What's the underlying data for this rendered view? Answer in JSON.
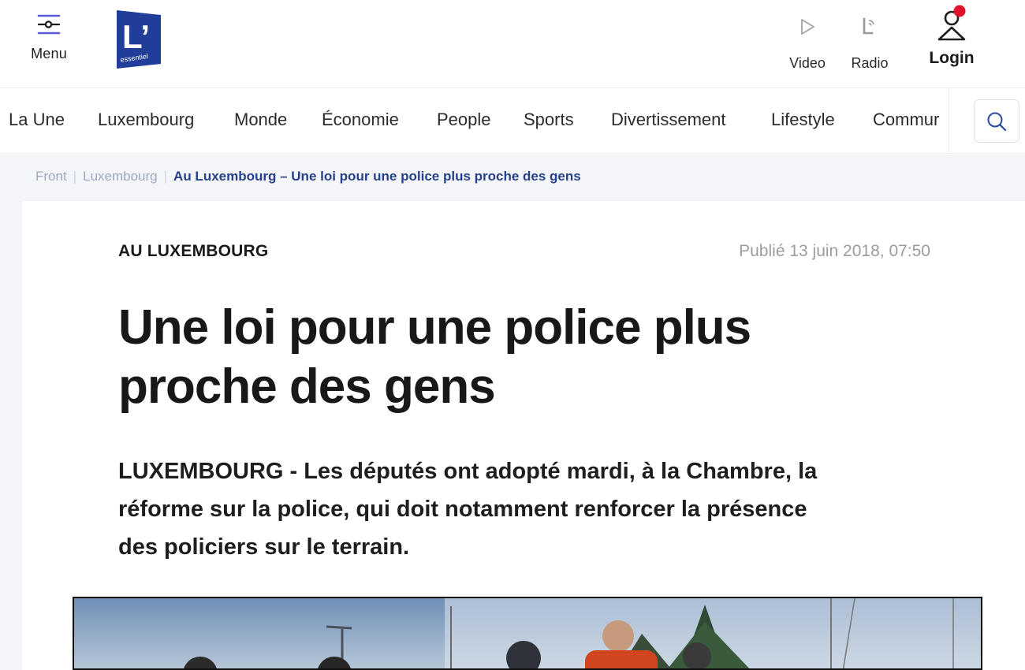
{
  "header": {
    "menu_label": "Menu",
    "logo_text": "L’",
    "logo_subtext": "essentiel",
    "video_label": "Video",
    "radio_label": "Radio",
    "login_label": "Login"
  },
  "nav": {
    "categories": [
      "La Une",
      "Luxembourg",
      "Monde",
      "Économie",
      "People",
      "Sports",
      "Divertissement",
      "Lifestyle",
      "Commur"
    ]
  },
  "breadcrumb": {
    "items": [
      "Front",
      "Luxembourg"
    ],
    "current": "Au Luxembourg – Une loi pour une police plus proche des gens"
  },
  "article": {
    "kicker": "AU LUXEMBOURG",
    "published": "Publié 13 juin 2018, 07:50",
    "headline_line1": "Une loi pour une police plus",
    "headline_line2": "proche des gens",
    "lead_line1": "LUXEMBOURG - Les députés ont adopté mardi, à la Chambre, la",
    "lead_line2": "réforme sur la police, qui doit notamment renforcer la présence",
    "lead_line3": "des policiers sur le terrain."
  },
  "colors": {
    "brand_blue": "#1f3d99",
    "menu_accent": "#5b5bd6",
    "notification_dot": "#e0112b",
    "breadcrumb_current": "#27408b"
  },
  "icons": {
    "menu": "menu-sliders-icon",
    "video": "play-icon",
    "radio": "radio-icon",
    "login": "user-icon",
    "search": "search-icon"
  }
}
